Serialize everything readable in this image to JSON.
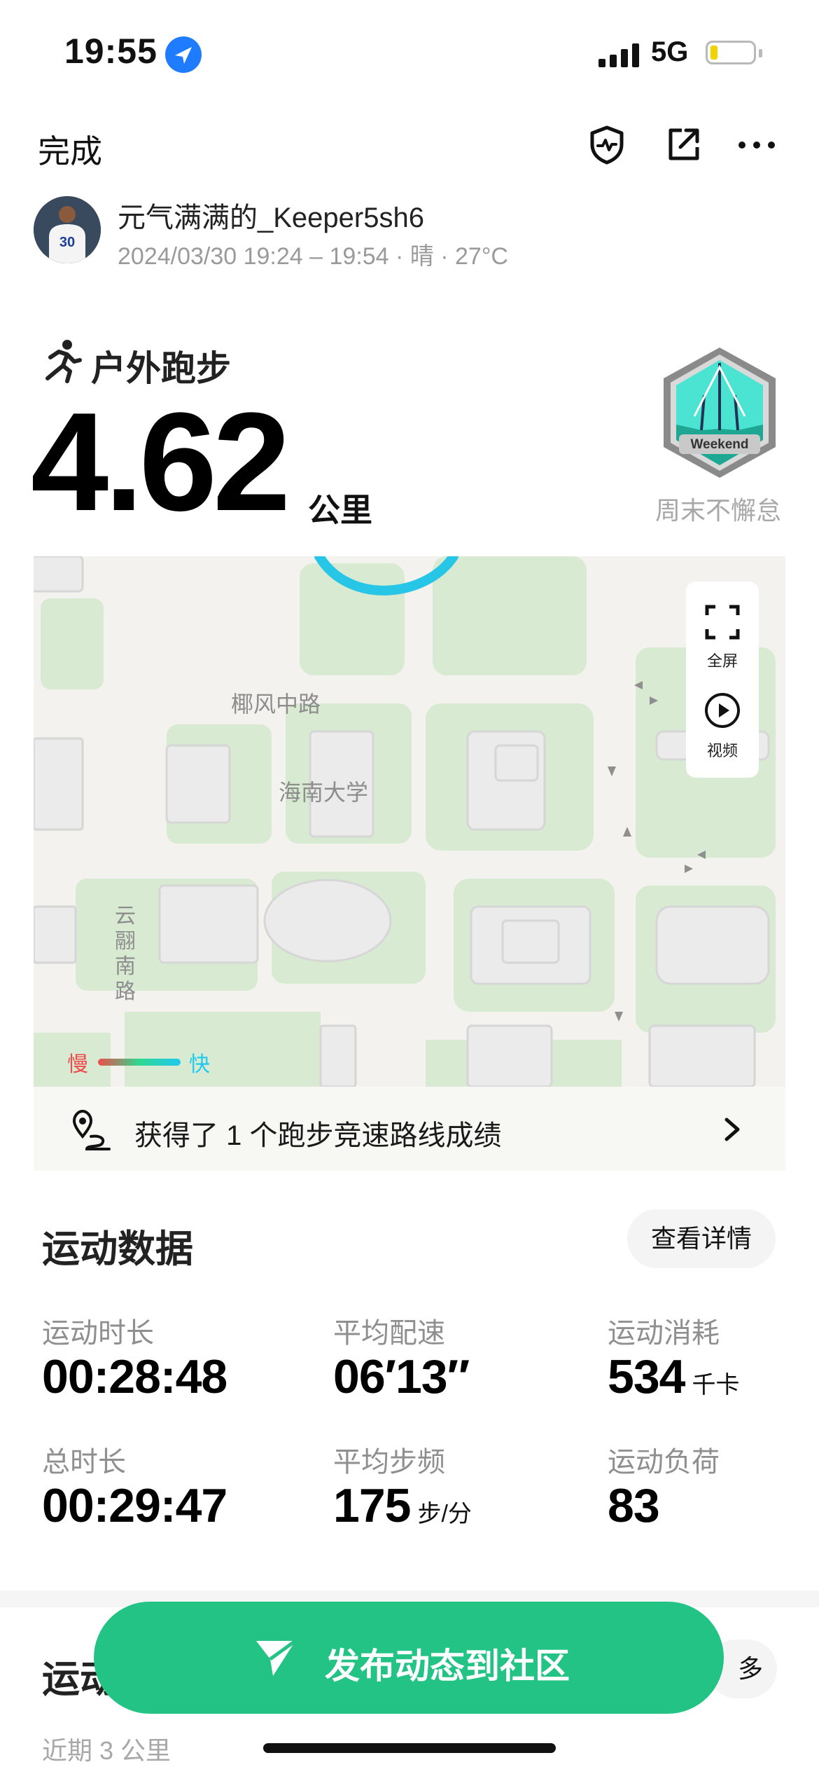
{
  "status_bar": {
    "time": "19:55",
    "network": "5G"
  },
  "header": {
    "done_label": "完成"
  },
  "user": {
    "name": "元气满满的_Keeper5sh6",
    "info": "2024/03/30 19:24 – 19:54 · 晴 · 27°C",
    "jersey_number": "30"
  },
  "workout": {
    "type": "户外跑步",
    "distance": "4.62",
    "distance_unit": "公里",
    "badge_text": "Weekend",
    "badge_label": "周末不懈怠"
  },
  "map": {
    "labels": {
      "road1": "椰风中路",
      "university": "海南大学",
      "road2": "云翮南路"
    },
    "legend": {
      "slow": "慢",
      "fast": "快"
    },
    "controls": {
      "fullscreen": "全屏",
      "video": "视频"
    }
  },
  "achievement": {
    "text": "获得了 1 个跑步竞速路线成绩"
  },
  "stats": {
    "title": "运动数据",
    "detail_button": "查看详情",
    "items": [
      {
        "label": "运动时长",
        "value": "00:28:48",
        "unit": ""
      },
      {
        "label": "平均配速",
        "value": "06′13″",
        "unit": ""
      },
      {
        "label": "运动消耗",
        "value": "534",
        "unit": "千卡"
      },
      {
        "label": "总时长",
        "value": "00:29:47",
        "unit": ""
      },
      {
        "label": "平均步频",
        "value": "175",
        "unit": "步/分"
      },
      {
        "label": "运动负荷",
        "value": "83",
        "unit": ""
      }
    ]
  },
  "section2": {
    "title_partial": "运动",
    "more_partial": "多",
    "recent": "近期 3 公里"
  },
  "publish": {
    "label": "发布动态到社区"
  },
  "colors": {
    "accent": "#22c385",
    "route": "#27c6e6",
    "slow": "#ef4b4b",
    "fast": "#1ec9f0"
  }
}
